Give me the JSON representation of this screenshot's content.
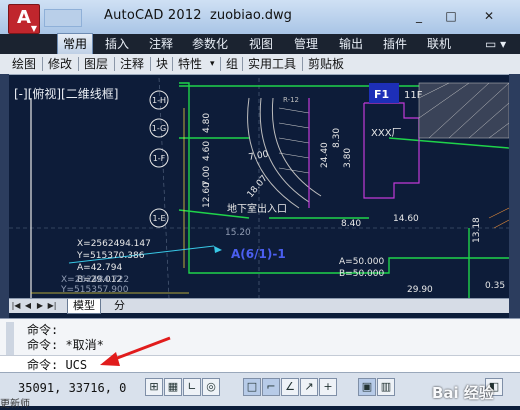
{
  "window": {
    "app_title": "AutoCAD 2012",
    "file_name": "zuobiao.dwg",
    "logo_letter": "A",
    "buttons": [
      "_",
      "□",
      "✕"
    ]
  },
  "ribbon_tabs": [
    "常用",
    "插入",
    "注释",
    "参数化",
    "视图",
    "管理",
    "输出",
    "插件",
    "联机"
  ],
  "ribbon_extra": "▭ ▾",
  "toolbar_items": [
    "绘图",
    "修改",
    "图层",
    "注释",
    "块",
    "特性",
    "组",
    "实用工具",
    "剪贴板"
  ],
  "toolbar_dropdown_marker": "▾",
  "viewport_label": "[-][俯视][二维线框]",
  "drawing": {
    "annotations": {
      "label_f1": "F1",
      "label_11f": "11F",
      "label_xxx": "XXX厂",
      "point_label": "A(6/1)-1",
      "coord_x": "X=2562494.147",
      "coord_y": "Y=515370.386",
      "coord_a": "A=42.794",
      "coord_b": "B=29.012",
      "coord_x2": "X=262484.722",
      "coord_y2": "Y=515357.900",
      "a50": "A=50.000",
      "b50": "B=50.000",
      "road_label": "地下室出入口",
      "axis_1h": "1-H",
      "axis_1g": "1-G",
      "axis_1f": "1-F",
      "axis_1e": "1-E",
      "dims": [
        "4.80",
        "4.60",
        "7.00",
        "12.60",
        "8.30",
        "24.40",
        "3.80",
        "13.18",
        "8.40",
        "14.60",
        "7.00",
        "18.07",
        "15.20",
        "29.90",
        "0.35",
        "R-12"
      ]
    }
  },
  "layout_tabs": {
    "model": "模型",
    "layout": "分"
  },
  "command_window": {
    "lines": [
      "命令:",
      "命令: *取消*"
    ],
    "current": "命令: UCS"
  },
  "status_bar": {
    "coordinates": "35091, 33716, 0",
    "toggles": [
      "snap",
      "grid",
      "ortho",
      "polar",
      "osnap",
      "otrack",
      "ducs",
      "dyn",
      "lwt",
      "tpy",
      "qp",
      "sc"
    ]
  },
  "watermark": "Bai 经验",
  "below_text": "更新师"
}
